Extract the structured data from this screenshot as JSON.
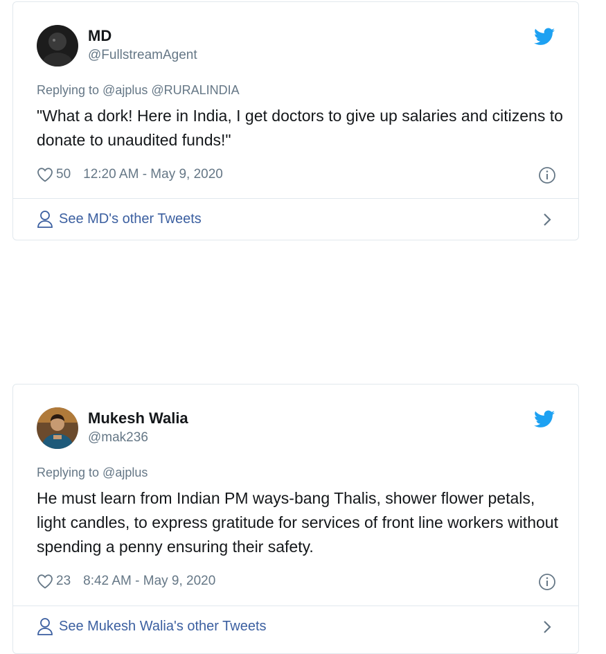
{
  "tweets": [
    {
      "display_name": "MD",
      "handle": "@FullstreamAgent",
      "replying_to": "Replying to @ajplus @RURALINDIA",
      "text": "\"What a dork! Here in India, I get doctors to give up salaries and citizens to donate to unaudited funds!\"",
      "likes": "50",
      "timestamp": "12:20 AM - May 9, 2020",
      "see_more": "See MD's other Tweets"
    },
    {
      "display_name": "Mukesh Walia",
      "handle": "@mak236",
      "replying_to": "Replying to @ajplus",
      "text": "He must learn from Indian PM ways-bang Thalis, shower flower petals, light candles, to express gratitude for services of front line workers without spending a penny ensuring their safety.",
      "likes": "23",
      "timestamp": "8:42 AM - May 9, 2020",
      "see_more": "See Mukesh Walia's other Tweets"
    }
  ],
  "icons": {
    "brand": "twitter-bird-icon",
    "like": "heart-icon",
    "info": "info-icon",
    "profile": "user-icon",
    "more": "chevron-right-icon"
  },
  "colors": {
    "twitter_blue": "#1da1f2",
    "text_primary": "#14171a",
    "text_secondary": "#657786",
    "link": "#3b5fa0",
    "border": "#e1e8ed"
  }
}
